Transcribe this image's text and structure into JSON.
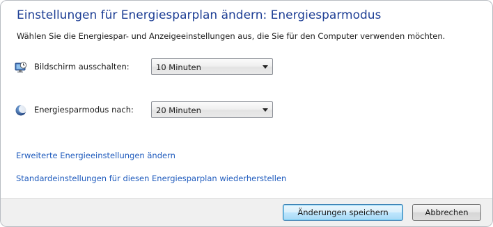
{
  "page": {
    "title": "Einstellungen für Energiesparplan ändern: Energiesparmodus",
    "subtitle": "Wählen Sie die Energiespar- und Anzeigeeinstellungen aus, die Sie für den Computer verwenden möchten."
  },
  "settings": [
    {
      "label": "Bildschirm ausschalten:",
      "icon": "monitor-clock-icon",
      "value": "10 Minuten"
    },
    {
      "label": "Energiesparmodus nach:",
      "icon": "moon-icon",
      "value": "20 Minuten"
    }
  ],
  "links": {
    "advanced": "Erweiterte Energieeinstellungen ändern",
    "restore": "Standardeinstellungen für diesen Energiesparplan wiederherstellen"
  },
  "buttons": {
    "save": "Änderungen speichern",
    "cancel": "Abbrechen"
  },
  "colors": {
    "title": "#1e3f95",
    "link": "#1f5bbd",
    "footer_bg": "#f0f0f0"
  }
}
